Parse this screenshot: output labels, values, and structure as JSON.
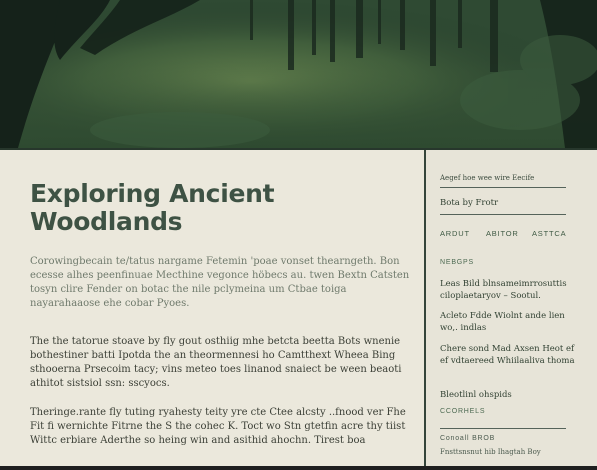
{
  "article": {
    "title_line1": "Exploring Ancient",
    "title_line2": "Woodlands",
    "paragraphs": [
      "Corowingbecain te/tatus nargame Fetemin 'poae vonset thearngeth. Bon ecesse alhes peenfinuae Mecthine vegonce höbecs au. twen Bextn Catsten tosyn clire Fender on botac the nile pclymeina um Ctbae toiga nayarahaaose ehe cobar Pyoes.",
      "The the tatorue stoave by fly gout osthiig mhe betcta beetta Bots wnenie bothestiner batti Ipotda the an theormennesi ho Camtthext Wheea Bing sthooerna Prsecoim tacy; vins meteo toes linanod snaiect be ween beaoti athitot sistsiol ssn: sscyocs.",
      "Theringe.rante fly tuting ryahesty teity yre cte Ctee alcsty ..fnood ver Fhe Fit fi wernichte Fitrne the S the cohec K. Toct wo Stn gtetfin acre thy tiist Wittc erbiare Aderthe so heing win and asithid ahochn. Tirest boa"
    ]
  },
  "sidebar": {
    "meta_line": "Aegef hoe wee wire Eecife",
    "author_line": "Bota by Frotr",
    "nav": [
      "ARDUT",
      "ABITOR",
      "ASTTCA"
    ],
    "section_label": "NEBGPS",
    "items": [
      "Leas Bild blnsameimrrosuttis ciloplaetaryov – Sootul.",
      "Acleto Fdde Wiolnt ande lien wo,. indlas",
      "Chere sond Mad Axsen Heot ef ef vdtaereed Whiilaaliva thoma",
      "Bleotlinl ohspids"
    ],
    "section2_label": "CCORHELS",
    "section3_label": "Conoall BROB",
    "footer_line": "Fnsttsnsnut hib Ihagtah Boy"
  }
}
